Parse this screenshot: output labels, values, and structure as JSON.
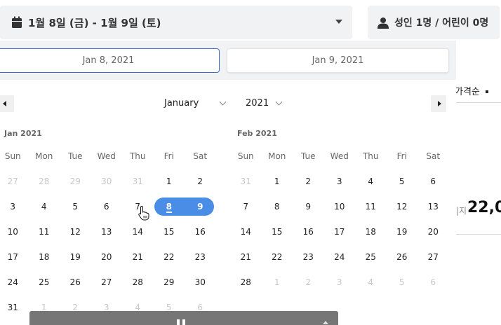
{
  "search": {
    "date_range": "1월 8일 (금) - 1월 9일 (토)",
    "guests": "성인 1명 / 어린이 0명"
  },
  "results": {
    "sort_label": "가격순",
    "price_prefix": "|지",
    "price": "22,0"
  },
  "picker": {
    "start_value": "Jan 8, 2021",
    "end_value": "Jan 9, 2021",
    "month_select": "January",
    "year_select": "2021",
    "weekdays": [
      "Sun",
      "Mon",
      "Tue",
      "Wed",
      "Thu",
      "Fri",
      "Sat"
    ],
    "months": [
      {
        "title": "Jan 2021",
        "weeks": [
          [
            "27",
            "28",
            "29",
            "30",
            "31",
            "1",
            "2"
          ],
          [
            "3",
            "4",
            "5",
            "6",
            "7",
            "8",
            "9"
          ],
          [
            "10",
            "11",
            "12",
            "13",
            "14",
            "15",
            "16"
          ],
          [
            "17",
            "18",
            "19",
            "20",
            "21",
            "22",
            "23"
          ],
          [
            "24",
            "25",
            "26",
            "27",
            "28",
            "29",
            "30"
          ],
          [
            "31",
            "1",
            "2",
            "3",
            "4",
            "5",
            "6"
          ]
        ]
      },
      {
        "title": "Feb 2021",
        "weeks": [
          [
            "31",
            "1",
            "2",
            "3",
            "4",
            "5",
            "6"
          ],
          [
            "7",
            "8",
            "9",
            "10",
            "11",
            "12",
            "13"
          ],
          [
            "14",
            "15",
            "16",
            "17",
            "18",
            "19",
            "20"
          ],
          [
            "21",
            "22",
            "23",
            "24",
            "25",
            "26",
            "27"
          ],
          [
            "28",
            "1",
            "2",
            "3",
            "4",
            "5",
            "6"
          ]
        ]
      }
    ]
  },
  "colors": {
    "accent": "#4a8de6",
    "input_focus": "#3b6ecb"
  }
}
